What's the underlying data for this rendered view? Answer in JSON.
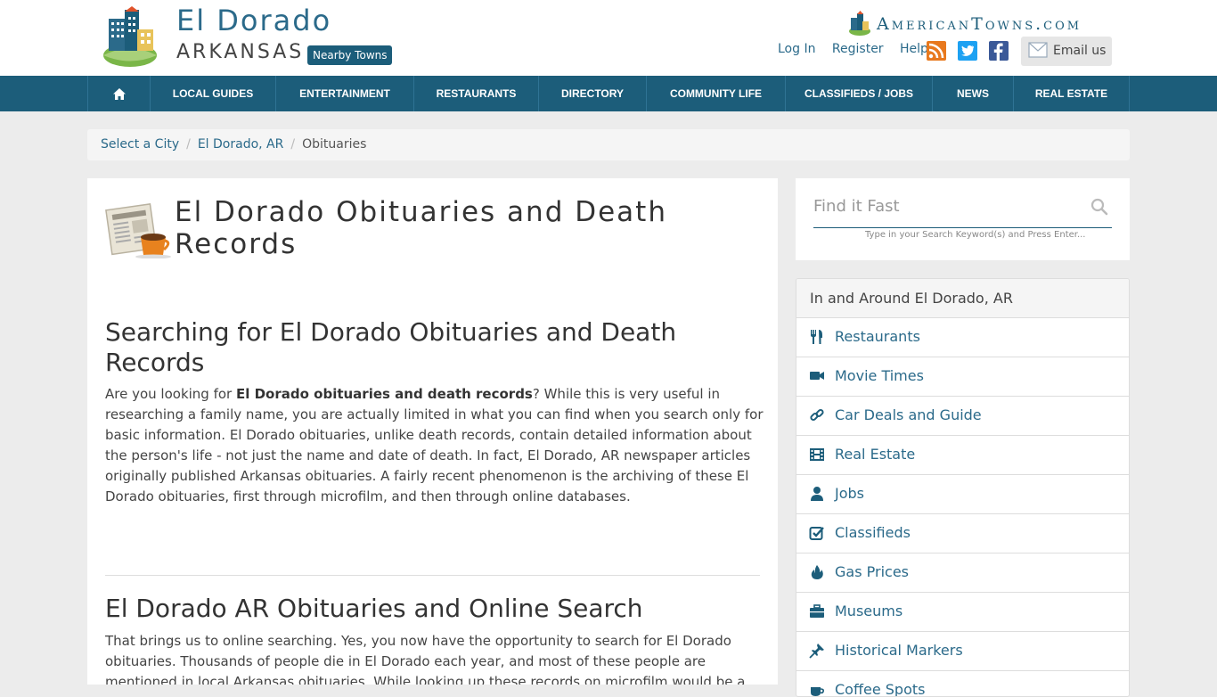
{
  "header": {
    "city": "El Dorado",
    "state": "ARKANSAS",
    "nearby_label": "Nearby Towns",
    "brand": "AmericanTowns.com",
    "links": [
      "Log In",
      "Register",
      "Help"
    ],
    "email_label": "Email us"
  },
  "nav": {
    "items": [
      {
        "label": "LOCAL GUIDES"
      },
      {
        "label": "ENTERTAINMENT"
      },
      {
        "label": "RESTAURANTS"
      },
      {
        "label": "DIRECTORY"
      },
      {
        "label": "COMMUNITY LIFE"
      },
      {
        "label": "CLASSIFIEDS / JOBS"
      },
      {
        "label": "NEWS"
      },
      {
        "label": "REAL ESTATE"
      }
    ]
  },
  "breadcrumb": {
    "items": [
      "Select a City",
      "El Dorado, AR"
    ],
    "current": "Obituaries"
  },
  "main": {
    "title": "El Dorado Obituaries and Death Records",
    "section1": {
      "heading": "Searching for El Dorado Obituaries and Death Records",
      "intro": "Are you looking for ",
      "bold": "El Dorado obituaries and death records",
      "body": "? While this is very useful in researching a family name, you are actually limited in what you can find when you search only for basic information. El Dorado obituaries, unlike death records, contain detailed information about the person's life - not just the name and date of death. In fact, El Dorado, AR newspaper articles originally published Arkansas obituaries. A fairly recent phenomenon is the archiving of these El Dorado obituaries, first through microfilm, and then through online databases."
    },
    "section2": {
      "heading": "El Dorado AR Obituaries and Online Search",
      "body": "That brings us to online searching. Yes, you now have the opportunity to search for El Dorado obituaries. Thousands of people die in El Dorado each year, and most of these people are mentioned in local Arkansas obituaries. While looking up these records on microfilm would be a"
    }
  },
  "search": {
    "placeholder": "Find it Fast",
    "hint": "Type in your Search Keyword(s) and Press Enter..."
  },
  "sidebar": {
    "heading": "In and Around El Dorado, AR",
    "items": [
      {
        "label": "Restaurants",
        "icon": "cutlery-icon"
      },
      {
        "label": "Movie Times",
        "icon": "video-camera-icon"
      },
      {
        "label": "Car Deals and Guide",
        "icon": "link-icon"
      },
      {
        "label": "Real Estate",
        "icon": "film-icon"
      },
      {
        "label": "Jobs",
        "icon": "user-icon"
      },
      {
        "label": "Classifieds",
        "icon": "check-square-icon"
      },
      {
        "label": "Gas Prices",
        "icon": "fire-icon"
      },
      {
        "label": "Museums",
        "icon": "briefcase-icon"
      },
      {
        "label": "Historical Markers",
        "icon": "pushpin-icon"
      },
      {
        "label": "Coffee Spots",
        "icon": "coffee-icon"
      }
    ]
  },
  "colors": {
    "primary": "#1c5d7a",
    "link": "#2b6a8a",
    "background": "#ececec"
  }
}
